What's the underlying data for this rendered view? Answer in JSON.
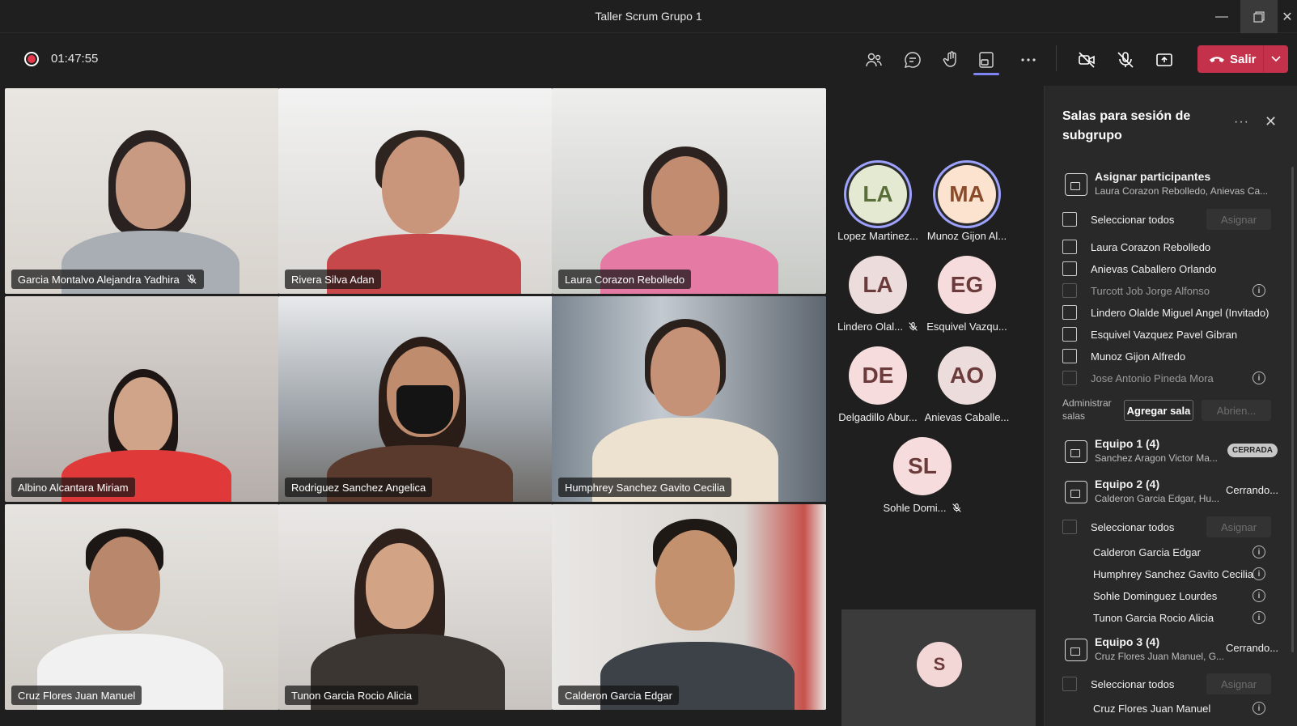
{
  "window": {
    "title": "Taller Scrum Grupo 1",
    "minimize_icon": "minimize-icon",
    "restore_icon": "restore-icon",
    "close_icon": "close-icon"
  },
  "toolbar": {
    "timer": "01:47:55",
    "leave_label": "Salir",
    "icons": [
      "people-icon",
      "chat-icon",
      "raise-hand-icon",
      "breakout-rooms-icon",
      "more-icon",
      "camera-off-icon",
      "mic-off-icon",
      "share-icon"
    ]
  },
  "colors": {
    "accent": "#9ea2ff",
    "leave": "#c4314b",
    "record": "#e3394a"
  },
  "videos": [
    {
      "name": "Garcia Montalvo Alejandra Yadhira",
      "muted": true
    },
    {
      "name": "Rivera Silva Adan",
      "muted": false
    },
    {
      "name": "Laura Corazon Rebolledo",
      "muted": false
    },
    {
      "name": "Albino Alcantara Miriam",
      "muted": false
    },
    {
      "name": "Rodriguez Sanchez Angelica",
      "muted": false,
      "speaking": true
    },
    {
      "name": "Humphrey Sanchez Gavito Cecilia",
      "muted": false,
      "speaking": true
    },
    {
      "name": "Cruz Flores Juan Manuel",
      "muted": false
    },
    {
      "name": "Tunon Garcia Rocio Alicia",
      "muted": false
    },
    {
      "name": "Calderon Garcia Edgar",
      "muted": false
    }
  ],
  "avatars": [
    {
      "initials": "LA",
      "label": "Lopez Martinez...",
      "color": "#e4ead2",
      "speaking": true,
      "muted": false
    },
    {
      "initials": "MA",
      "label": "Munoz Gijon Al...",
      "color": "#fbe3cf",
      "speaking": true,
      "muted": false
    },
    {
      "initials": "LA",
      "label": "Lindero Olal...",
      "color": "#ecdcdc",
      "speaking": false,
      "muted": true
    },
    {
      "initials": "EG",
      "label": "Esquivel Vazqu...",
      "color": "#f6dcdc",
      "speaking": false,
      "muted": false
    },
    {
      "initials": "DE",
      "label": "Delgadillo Abur...",
      "color": "#f6dcdc",
      "speaking": false,
      "muted": false
    },
    {
      "initials": "AO",
      "label": "Anievas Caballe...",
      "color": "#ecdcdc",
      "speaking": false,
      "muted": false
    },
    {
      "initials": "SL",
      "label": "Sohle Domi...",
      "color": "#f6dcdc",
      "speaking": false,
      "muted": true
    }
  ],
  "self_view": {
    "initials": "S"
  },
  "panel": {
    "title": "Salas para sesión de subgrupo",
    "more": "···",
    "assign": {
      "title": "Asignar participantes",
      "subtitle": "Laura Corazon Rebolledo, Anievas Ca..."
    },
    "select_all": "Seleccionar todos",
    "assign_button": "Asignar",
    "unassigned": [
      {
        "name": "Laura Corazon Rebolledo",
        "disabled": false,
        "info": false
      },
      {
        "name": "Anievas Caballero Orlando",
        "disabled": false,
        "info": false
      },
      {
        "name": "Turcott Job Jorge Alfonso",
        "disabled": true,
        "info": true
      },
      {
        "name": "Lindero Olalde Miguel Angel (Invitado)",
        "disabled": false,
        "info": false
      },
      {
        "name": "Esquivel Vazquez Pavel Gibran",
        "disabled": false,
        "info": false
      },
      {
        "name": "Munoz Gijon Alfredo",
        "disabled": false,
        "info": false
      },
      {
        "name": "Jose Antonio Pineda Mora",
        "disabled": true,
        "info": true
      }
    ],
    "admin_label": "Administrar salas",
    "add_room": "Agregar sala",
    "opening": "Abrien...",
    "rooms": [
      {
        "title": "Equipo 1 (4)",
        "subtitle": "Sanchez Aragon Victor Ma...",
        "status": "CERRADA"
      },
      {
        "title": "Equipo 2 (4)",
        "subtitle": "Calderon Garcia Edgar, Hu...",
        "status": "Cerrando..."
      },
      {
        "title": "Equipo 3 (4)",
        "subtitle": "Cruz Flores Juan Manuel, G...",
        "status": "Cerrando..."
      }
    ],
    "room2_members": [
      "Calderon Garcia Edgar",
      "Humphrey Sanchez Gavito Cecilia",
      "Sohle Dominguez Lourdes",
      "Tunon Garcia Rocio Alicia"
    ],
    "room3_members": [
      "Cruz Flores Juan Manuel"
    ]
  }
}
